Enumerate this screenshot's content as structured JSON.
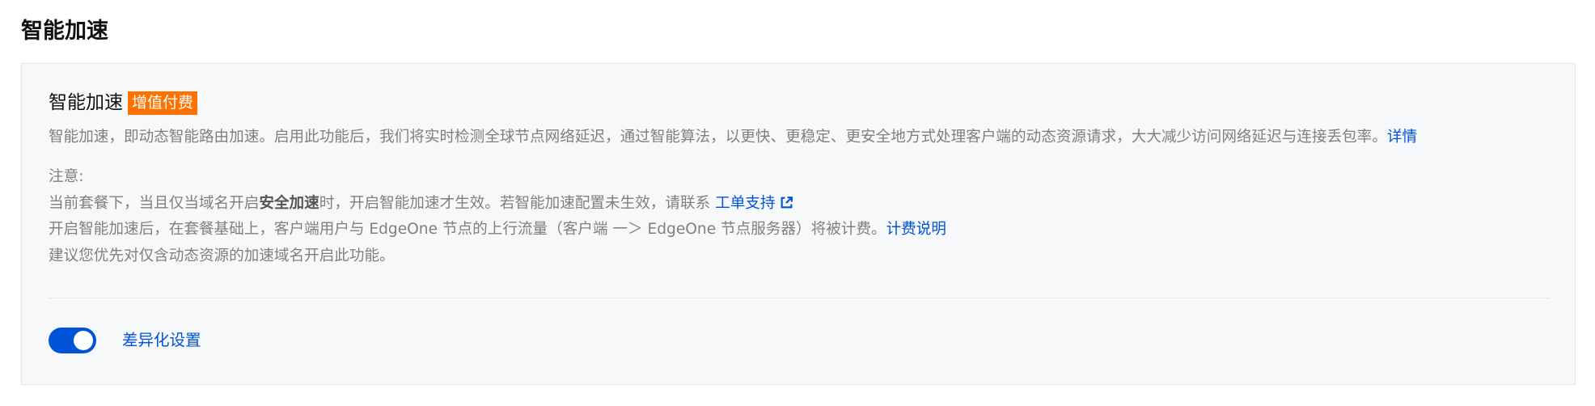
{
  "section": {
    "title": "智能加速"
  },
  "card": {
    "title": "智能加速",
    "badge": "增值付费",
    "description": "智能加速，即动态智能路由加速。启用此功能后，我们将实时检测全球节点网络延迟，通过智能算法，以更快、更稳定、更安全地方式处理客户端的动态资源请求，大大减少访问网络延迟与连接丢包率。",
    "details_link": "详情",
    "notes": {
      "heading": "注意:",
      "line1_prefix": "当前套餐下，当且仅当域名开启",
      "line1_bold": "安全加速",
      "line1_suffix": "时，开启智能加速才生效。若智能加速配置未生效，请联系",
      "ticket_link": "工单支持",
      "line2_text": "开启智能加速后，在套餐基础上，客户端用户与 EdgeOne 节点的上行流量（客户端 一＞ EdgeOne 节点服务器）将被计费。",
      "billing_link": "计费说明",
      "line3": "建议您优先对仅含动态资源的加速域名开启此功能。"
    },
    "toggle": {
      "on": true,
      "label": "差异化设置"
    }
  },
  "colors": {
    "accent": "#0052d9",
    "badge": "#ff7200"
  },
  "icons": {
    "ticket_link_icon": "external-link-icon"
  }
}
